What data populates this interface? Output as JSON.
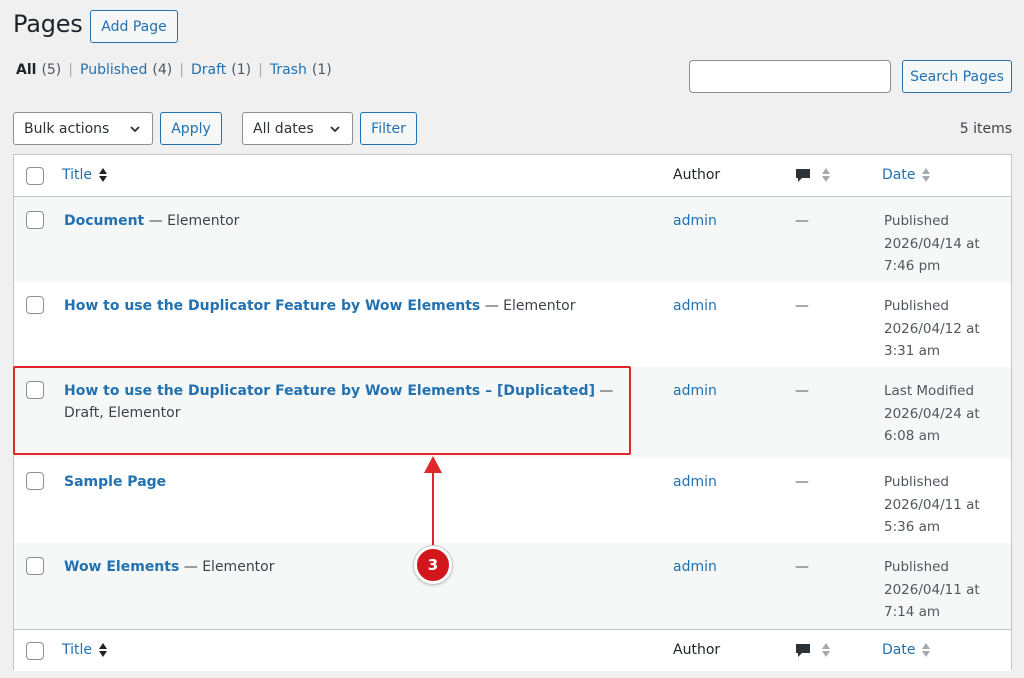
{
  "header": {
    "title": "Pages",
    "add_label": "Add Page"
  },
  "views": [
    {
      "label": "All",
      "count": "(5)",
      "current": true
    },
    {
      "label": "Published",
      "count": "(4)"
    },
    {
      "label": "Draft",
      "count": "(1)"
    },
    {
      "label": "Trash",
      "count": "(1)"
    }
  ],
  "search": {
    "button_label": "Search Pages",
    "value": ""
  },
  "bulk": {
    "selected": "Bulk actions",
    "apply_label": "Apply"
  },
  "dates": {
    "selected": "All dates",
    "filter_label": "Filter"
  },
  "items_count": "5 items",
  "columns": {
    "title": "Title",
    "author": "Author",
    "date": "Date"
  },
  "rows": [
    {
      "title": "Document",
      "suffix": " — Elementor",
      "author": "admin",
      "comments": "—",
      "status": "Published",
      "date": "2026/04/14 at",
      "time": "7:46 pm"
    },
    {
      "title": "How to use the Duplicator Feature by Wow Elements",
      "suffix": " — Elementor",
      "author": "admin",
      "comments": "—",
      "status": "Published",
      "date": "2026/04/12 at",
      "time": "3:31 am"
    },
    {
      "title": "How to use the Duplicator Feature by Wow Elements – [Duplicated]",
      "suffix": " — Draft, Elementor",
      "author": "admin",
      "comments": "—",
      "status": "Last Modified",
      "date": "2026/04/24 at",
      "time": "6:08 am"
    },
    {
      "title": "Sample Page",
      "suffix": "",
      "author": "admin",
      "comments": "—",
      "status": "Published",
      "date": "2026/04/11 at",
      "time": "5:36 am"
    },
    {
      "title": "Wow Elements",
      "suffix": " — Elementor",
      "author": "admin",
      "comments": "—",
      "status": "Published",
      "date": "2026/04/11 at",
      "time": "7:14 am"
    }
  ],
  "annotation": {
    "step": "3"
  },
  "colors": {
    "link": "#2271b1",
    "annotation": "#e0262b",
    "badge": "#d3161c"
  }
}
